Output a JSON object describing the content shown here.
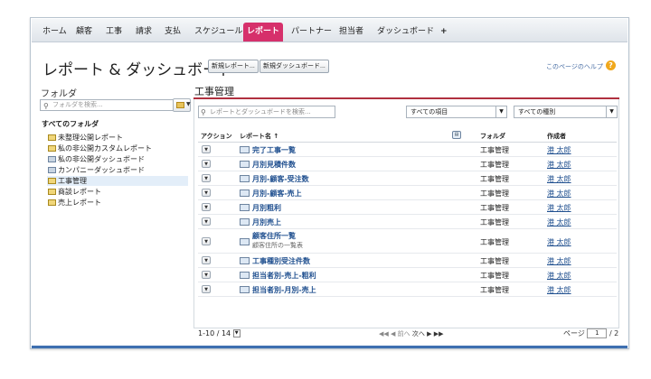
{
  "nav": {
    "tabs": [
      "ホーム",
      "顧客",
      "工事",
      "請求",
      "支払",
      "スケジュール",
      "レポート",
      "パートナー",
      "担当者",
      "ダッシュボード",
      "+"
    ],
    "active_index": 6
  },
  "header": {
    "title": "レポート & ダッシュボード",
    "new_report_button": "新規レポート...",
    "new_dashboard_button": "新規ダッシュボード...",
    "help_link": "このページのヘルプ",
    "help_icon": "?"
  },
  "sidebar": {
    "label": "フォルダ",
    "search_placeholder": "フォルダを検索...",
    "all_folders": "すべてのフォルダ",
    "items": [
      {
        "label": "未整理公開レポート",
        "icon": "folder-icon"
      },
      {
        "label": "私の非公開カスタムレポート",
        "icon": "folder-icon"
      },
      {
        "label": "私の非公開ダッシュボード",
        "icon": "dashboard-folder-icon"
      },
      {
        "label": "カンパニーダッシュボード",
        "icon": "dashboard-folder-icon"
      },
      {
        "label": "工事管理",
        "icon": "folder-icon"
      },
      {
        "label": "商談レポート",
        "icon": "folder-icon"
      },
      {
        "label": "売上レポート",
        "icon": "folder-icon"
      }
    ],
    "selected_index": 4
  },
  "main": {
    "title": "工事管理",
    "search_placeholder": "レポートとダッシュボードを検索...",
    "filter_items": "すべての項目",
    "filter_types": "すべての種別",
    "columns": {
      "action": "アクション",
      "name": "レポート名 ↑",
      "folder": "フォルダ",
      "author": "作成者"
    },
    "rows": [
      {
        "name": "完了工事一覧",
        "desc": "",
        "folder": "工事管理",
        "author": "港 太郎"
      },
      {
        "name": "月別見積件数",
        "desc": "",
        "folder": "工事管理",
        "author": "港 太郎"
      },
      {
        "name": "月別-顧客-受注数",
        "desc": "",
        "folder": "工事管理",
        "author": "港 太郎"
      },
      {
        "name": "月別-顧客-売上",
        "desc": "",
        "folder": "工事管理",
        "author": "港 太郎"
      },
      {
        "name": "月別粗利",
        "desc": "",
        "folder": "工事管理",
        "author": "港 太郎"
      },
      {
        "name": "月別売上",
        "desc": "",
        "folder": "工事管理",
        "author": "港 太郎"
      },
      {
        "name": "顧客住所一覧",
        "desc": "顧客住所の一覧表",
        "folder": "工事管理",
        "author": "港 太郎"
      },
      {
        "name": "工事種別受注件数",
        "desc": "",
        "folder": "工事管理",
        "author": "港 太郎"
      },
      {
        "name": "担当者別-売上-粗利",
        "desc": "",
        "folder": "工事管理",
        "author": "港 太郎"
      },
      {
        "name": "担当者別-月別-売上",
        "desc": "",
        "folder": "工事管理",
        "author": "港 太郎"
      }
    ],
    "footer": {
      "count": "1-10 / 14",
      "pager_first": "◀◀",
      "pager_prev": "◀ 前へ",
      "pager_next": "次へ ▶",
      "pager_last": "▶▶",
      "page_label": "ページ",
      "page_current": "1",
      "page_total": "/ 2"
    }
  },
  "colors": {
    "accent": "#d6306b",
    "title_line": "#b0303f",
    "link": "#1f4f8f",
    "bottom_bar": "#3e6fb0"
  }
}
